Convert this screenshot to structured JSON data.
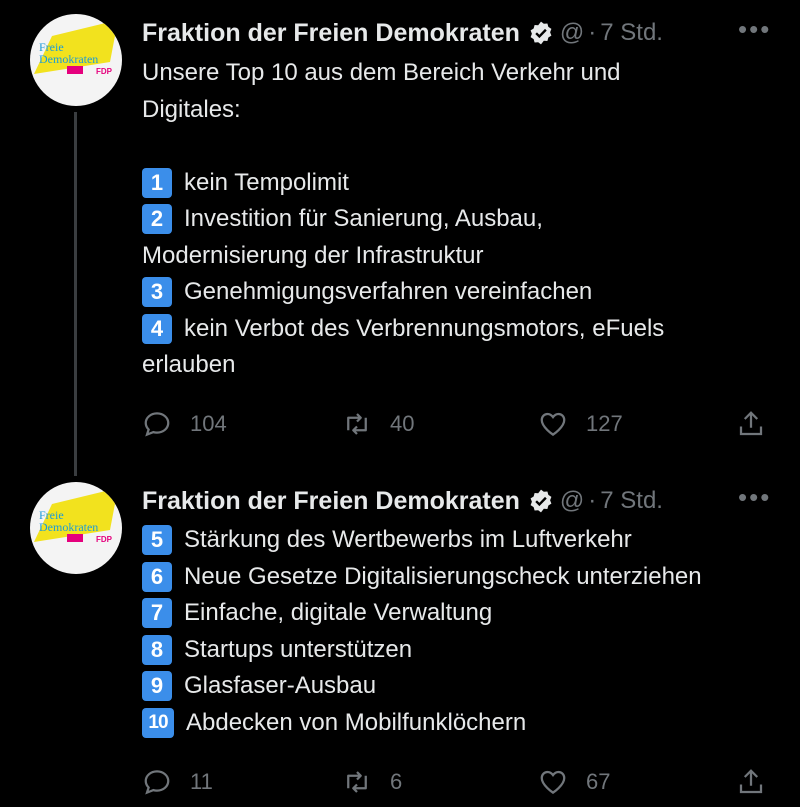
{
  "tweets": [
    {
      "author": "Fraktion der Freien Demokraten",
      "handle": "@",
      "separator": "·",
      "time": "7 Std.",
      "more": "•••",
      "avatar_text": [
        "Freie",
        "Demokraten",
        "FDP"
      ],
      "intro": [
        "Unsere Top 10 aus dem Bereich Verkehr und",
        "Digitales:"
      ],
      "items": [
        {
          "num": "1",
          "lines": [
            "kein Tempolimit"
          ]
        },
        {
          "num": "2",
          "lines": [
            "Investition für Sanierung, Ausbau,",
            "Modernisierung der Infrastruktur"
          ]
        },
        {
          "num": "3",
          "lines": [
            "Genehmigungsverfahren vereinfachen"
          ]
        },
        {
          "num": "4",
          "lines": [
            "kein Verbot des Verbrennungsmotors, eFuels",
            "erlauben"
          ]
        }
      ],
      "replies": "104",
      "retweets": "40",
      "likes": "127"
    },
    {
      "author": "Fraktion der Freien Demokraten",
      "handle": "@",
      "separator": "·",
      "time": "7 Std.",
      "more": "•••",
      "avatar_text": [
        "Freie",
        "Demokraten",
        "FDP"
      ],
      "items": [
        {
          "num": "5",
          "lines": [
            "Stärkung des Wertbewerbs im Luftverkehr"
          ]
        },
        {
          "num": "6",
          "lines": [
            "Neue Gesetze Digitalisierungscheck unterziehen"
          ]
        },
        {
          "num": "7",
          "lines": [
            "Einfache, digitale Verwaltung"
          ]
        },
        {
          "num": "8",
          "lines": [
            "Startups unterstützen"
          ]
        },
        {
          "num": "9",
          "lines": [
            "Glasfaser-Ausbau"
          ]
        },
        {
          "num": "10",
          "lines": [
            "Abdecken von Mobilfunklöchern"
          ]
        }
      ],
      "replies": "11",
      "retweets": "6",
      "likes": "67"
    }
  ],
  "colors": {
    "background": "#000000",
    "text": "#e7e9ea",
    "muted": "#71767b",
    "keycap": "#3b8eea",
    "thread_line": "#3a3d40",
    "logo_yellow": "#f2e21e",
    "logo_blue": "#1b9bd8",
    "logo_magenta": "#e5007d"
  },
  "icons": [
    "verified-badge-icon",
    "more-icon",
    "reply-icon",
    "retweet-icon",
    "like-icon",
    "share-icon"
  ]
}
